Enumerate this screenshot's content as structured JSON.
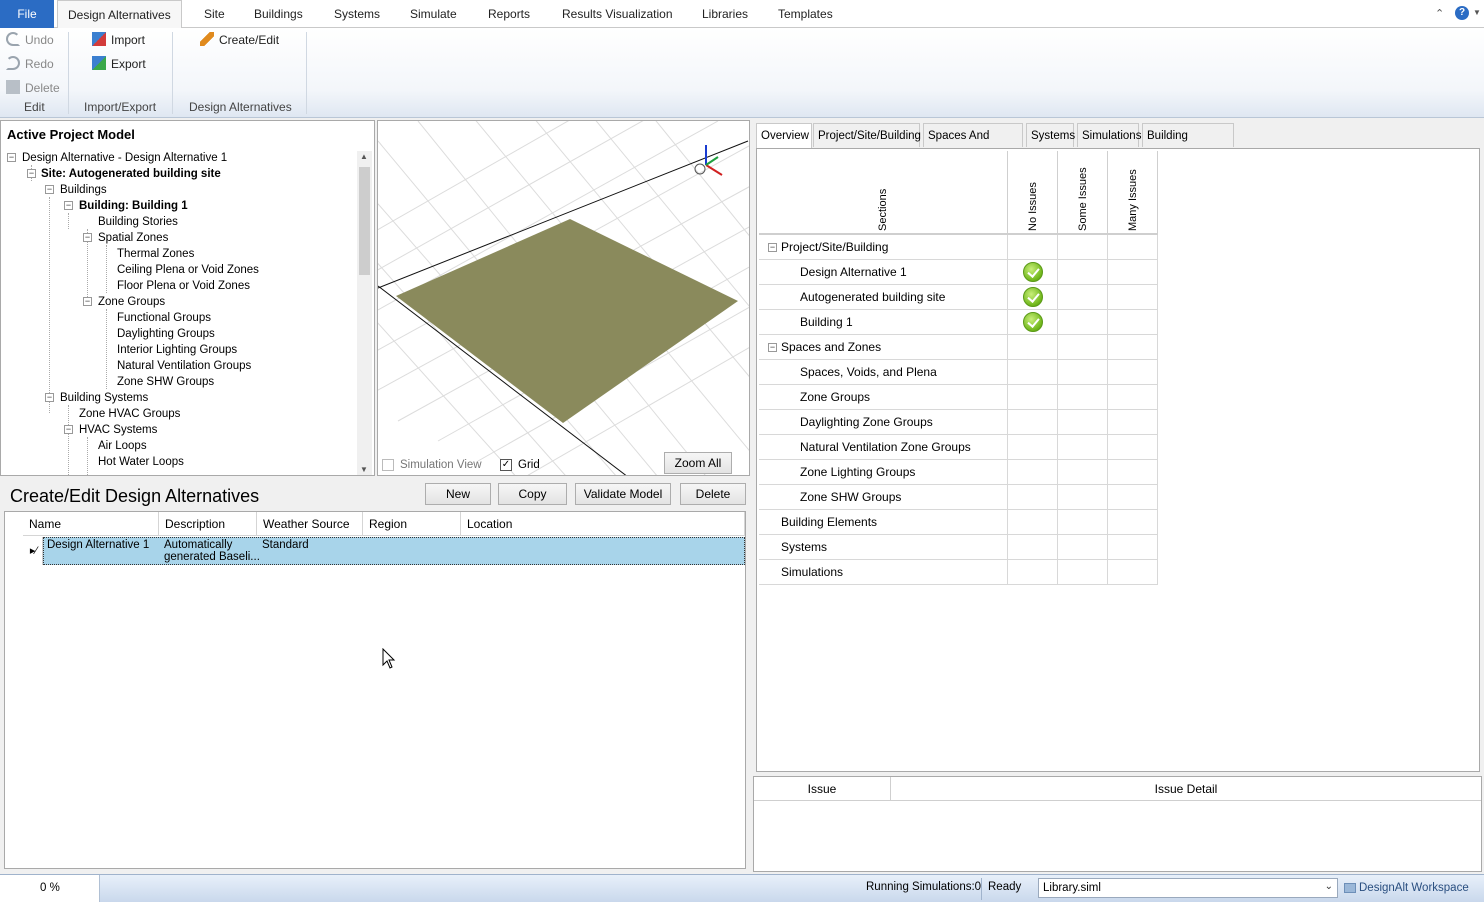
{
  "menu": {
    "file": "File",
    "tabs": [
      "Design Alternatives",
      "Site",
      "Buildings",
      "Systems",
      "Simulate",
      "Reports",
      "Results Visualization",
      "Libraries",
      "Templates"
    ]
  },
  "ribbon": {
    "undo": "Undo",
    "redo": "Redo",
    "delete": "Delete",
    "edit_group": "Edit",
    "import": "Import",
    "export": "Export",
    "import_export_group": "Import/Export",
    "create_edit": "Create/Edit",
    "design_alt_group": "Design Alternatives"
  },
  "tree": {
    "title": "Active Project Model",
    "nodes": [
      "Design Alternative - Design Alternative 1",
      "Site: Autogenerated building site",
      "Buildings",
      "Building: Building  1",
      "Building Stories",
      "Spatial Zones",
      "Thermal Zones",
      "Ceiling Plena or Void Zones",
      "Floor Plena or Void Zones",
      "Zone Groups",
      "Functional Groups",
      "Daylighting Groups",
      "Interior Lighting Groups",
      "Natural Ventilation Groups",
      "Zone SHW Groups",
      "Building Systems",
      "Zone HVAC Groups",
      "HVAC Systems",
      "Air Loops",
      "Hot Water Loops"
    ]
  },
  "view3d": {
    "simulation_view": "Simulation View",
    "grid": "Grid",
    "zoom_all": "Zoom All"
  },
  "create_edit": {
    "title": "Create/Edit Design Alternatives",
    "buttons": {
      "new": "New",
      "copy": "Copy",
      "validate": "Validate Model",
      "delete": "Delete"
    },
    "columns": [
      "Name",
      "Description",
      "Weather Source",
      "Region",
      "Location"
    ],
    "rows": [
      {
        "name": "Design Alternative 1",
        "description_l1": "Automatically",
        "description_l2": "generated Baseli...",
        "weather": "Standard",
        "region": "",
        "location": ""
      }
    ]
  },
  "right_tabs": [
    "Overview",
    "Project/Site/Building",
    "Spaces And Zones",
    "Systems",
    "Simulations",
    "Building Elements"
  ],
  "overview": {
    "headers": {
      "sections": "Sections",
      "no_issues": "No Issues",
      "some_issues": "Some Issues",
      "many_issues": "Many Issues"
    },
    "rows": [
      {
        "label": "Project/Site/Building",
        "group": true,
        "status": ""
      },
      {
        "label": "Design Alternative 1",
        "group": false,
        "status": "ok"
      },
      {
        "label": "Autogenerated building site",
        "group": false,
        "status": "ok"
      },
      {
        "label": "Building  1",
        "group": false,
        "status": "ok"
      },
      {
        "label": "Spaces and Zones",
        "group": true,
        "status": ""
      },
      {
        "label": "Spaces, Voids, and Plena",
        "group": false,
        "status": ""
      },
      {
        "label": "Zone Groups",
        "group": false,
        "status": ""
      },
      {
        "label": "Daylighting Zone Groups",
        "group": false,
        "status": ""
      },
      {
        "label": "Natural Ventilation Zone Groups",
        "group": false,
        "status": ""
      },
      {
        "label": "Zone Lighting Groups",
        "group": false,
        "status": ""
      },
      {
        "label": "Zone SHW Groups",
        "group": false,
        "status": ""
      },
      {
        "label": "Building Elements",
        "group": false,
        "status": ""
      },
      {
        "label": "Systems",
        "group": false,
        "status": ""
      },
      {
        "label": "Simulations",
        "group": false,
        "status": ""
      }
    ]
  },
  "issues": {
    "issue": "Issue",
    "detail": "Issue Detail"
  },
  "status": {
    "progress": "0 %",
    "running": "Running Simulations:0",
    "ready": "Ready",
    "library": "Library.siml",
    "workspace": "DesignAlt Workspace"
  },
  "colors": {
    "file_tab": "#2b6cc4",
    "selection": "#a8d4ea",
    "floor": "#8a8a5c",
    "check": "#6fb61a"
  }
}
